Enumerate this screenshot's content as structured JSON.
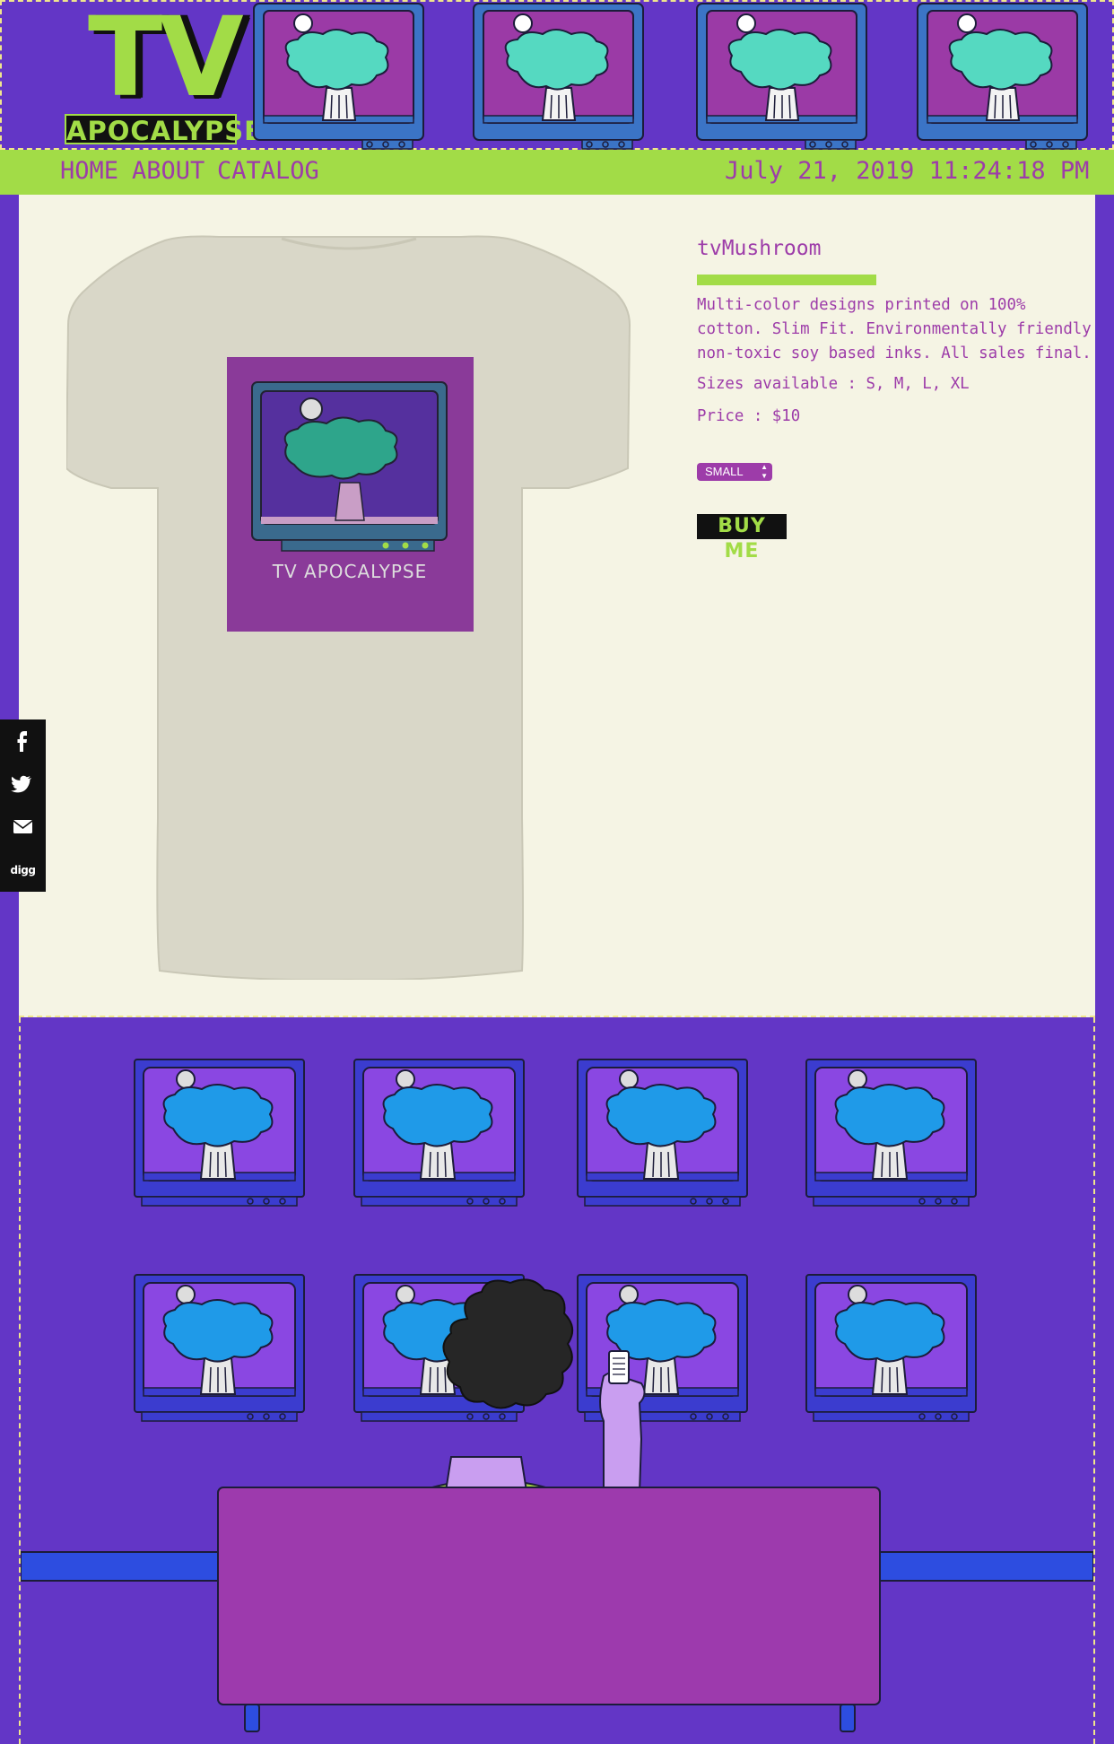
{
  "brand": {
    "title": "TV",
    "subtitle": "APOCALYPSE"
  },
  "nav": {
    "items": [
      "HOME",
      "ABOUT",
      "CATALOG"
    ],
    "datetime": "July 21, 2019 11:24:18 PM"
  },
  "product": {
    "name": "tvMushroom",
    "description": "Multi-color designs printed on 100% cotton. Slim Fit. Environmentally friendly non-toxic soy based inks. All sales final.",
    "sizes_text": "Sizes available : S, M, L, XL",
    "price_text": "Price : $10",
    "size_select": "SMALL",
    "buy_label": "BUY ME",
    "shirt_print_text": "TV APOCALYPSE"
  },
  "share": {
    "items": [
      "facebook-icon",
      "twitter-icon",
      "email-icon",
      "digg-icon"
    ],
    "digg_label": "digg"
  },
  "colors": {
    "purple": "#6336c6",
    "lime": "#a2dc47",
    "magenta": "#9d3ca9",
    "cream": "#f5f4e4"
  }
}
